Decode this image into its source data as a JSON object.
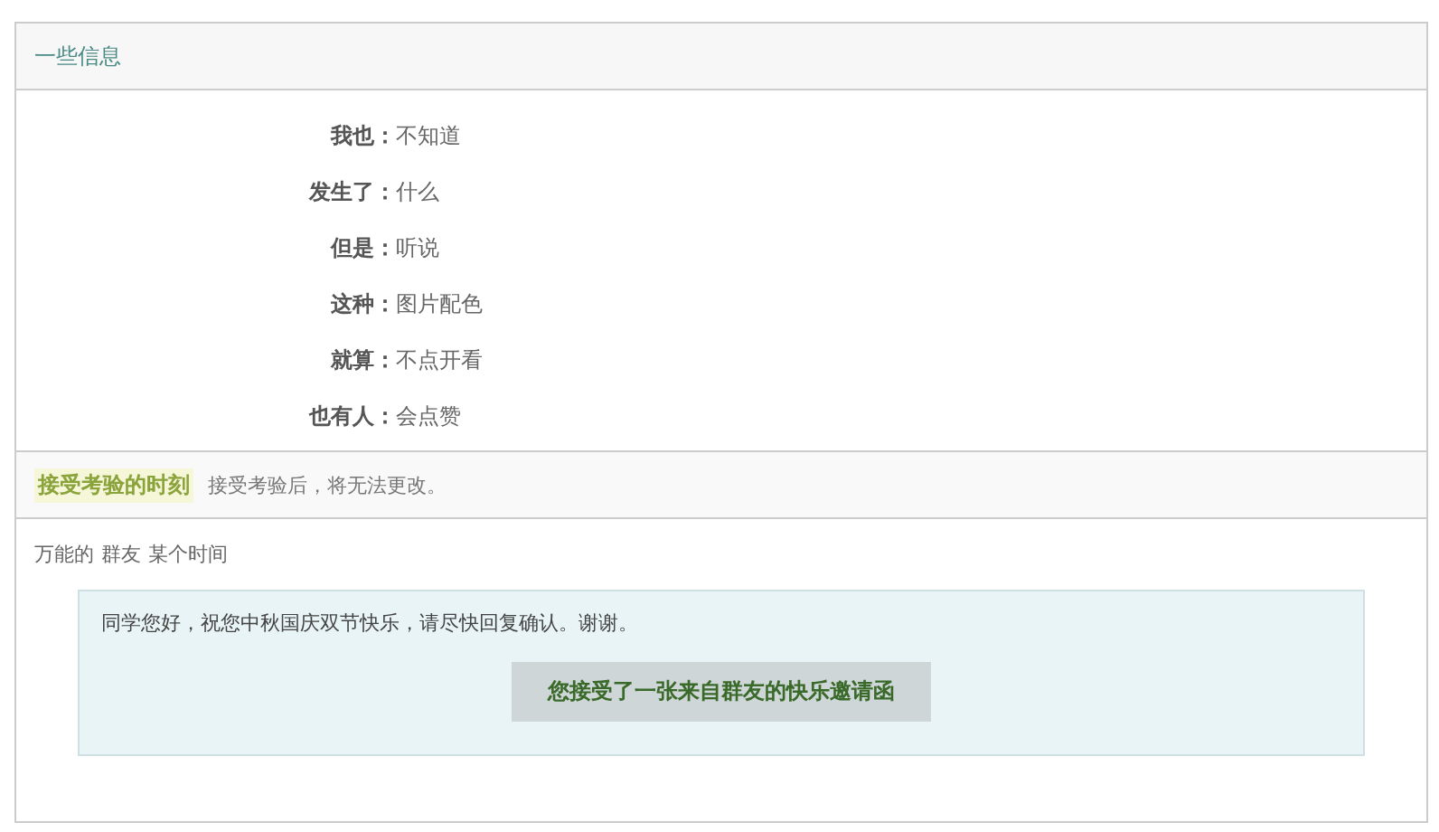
{
  "panel": {
    "title": "一些信息"
  },
  "fields": [
    {
      "label": "我也：",
      "value": "不知道"
    },
    {
      "label": "发生了：",
      "value": "什么"
    },
    {
      "label": "但是：",
      "value": "听说"
    },
    {
      "label": "这种：",
      "value": "图片配色"
    },
    {
      "label": "就算：",
      "value": "不点开看"
    },
    {
      "label": "也有人：",
      "value": "会点赞"
    }
  ],
  "section": {
    "title": "接受考验的时刻",
    "note": "接受考验后，将无法更改。"
  },
  "meta": {
    "author": "万能的",
    "group": "群友",
    "time": "某个时间"
  },
  "message": {
    "text": "同学您好，祝您中秋国庆双节快乐，请尽快回复确认。谢谢。",
    "button": "您接受了一张来自群友的快乐邀请函"
  }
}
